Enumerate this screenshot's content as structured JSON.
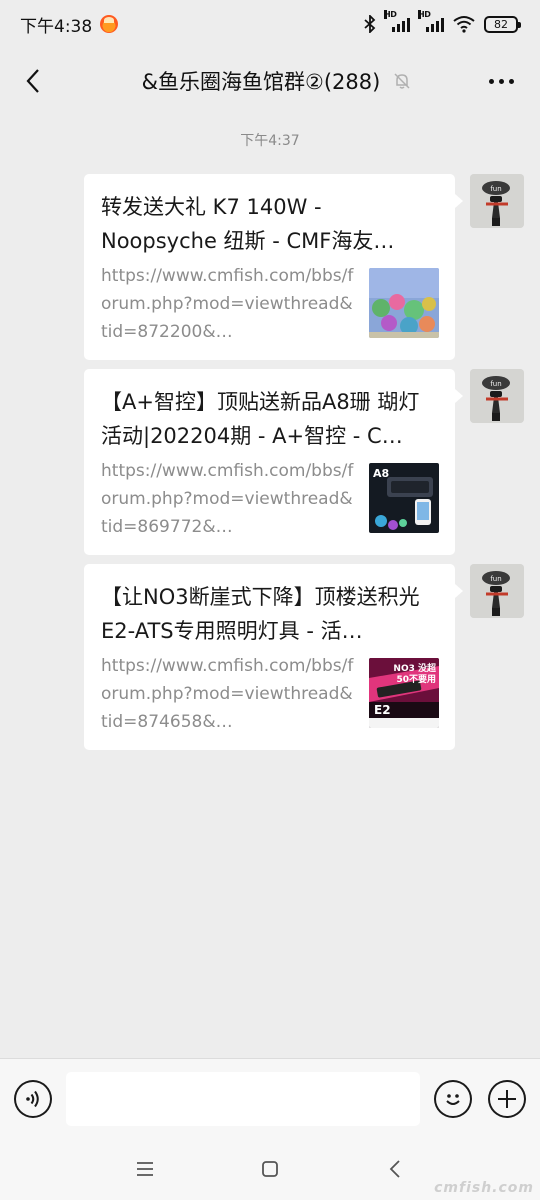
{
  "status_bar": {
    "time": "下午4:38",
    "battery": "82",
    "signal_label_1": "HD",
    "signal_label_2": "HD"
  },
  "nav": {
    "title": "&鱼乐圈海鱼馆群②(288)"
  },
  "chat": {
    "timestamp": "下午4:37",
    "messages": [
      {
        "title": "转发送大礼 K7 140W - Noopsyche 纽斯 - CMF海友…",
        "desc": "https://www.cmfish.com/bbs/forum.php?mod=viewthread&tid=872200&…",
        "thumb": "coral-tank-icon"
      },
      {
        "title": "【A+智控】顶贴送新品A8珊 瑚灯活动|202204期 - A+智控 - C…",
        "desc": "https://www.cmfish.com/bbs/forum.php?mod=viewthread&tid=869772&…",
        "thumb": "a8-light-icon",
        "thumb_text": "A8"
      },
      {
        "title": "【让NO3断崖式下降】顶楼送积光E2-ATS专用照明灯具 - 活…",
        "desc": "https://www.cmfish.com/bbs/forum.php?mod=viewthread&tid=874658&…",
        "thumb": "e2-light-icon",
        "thumb_text_1": "NO3 没超",
        "thumb_text_2": "50不要用",
        "thumb_text_3": "E2"
      }
    ]
  },
  "colors": {
    "background": "#ededed",
    "bubble": "#ffffff",
    "link_text": "#8c8c8c"
  },
  "watermark": "cmfish.com"
}
